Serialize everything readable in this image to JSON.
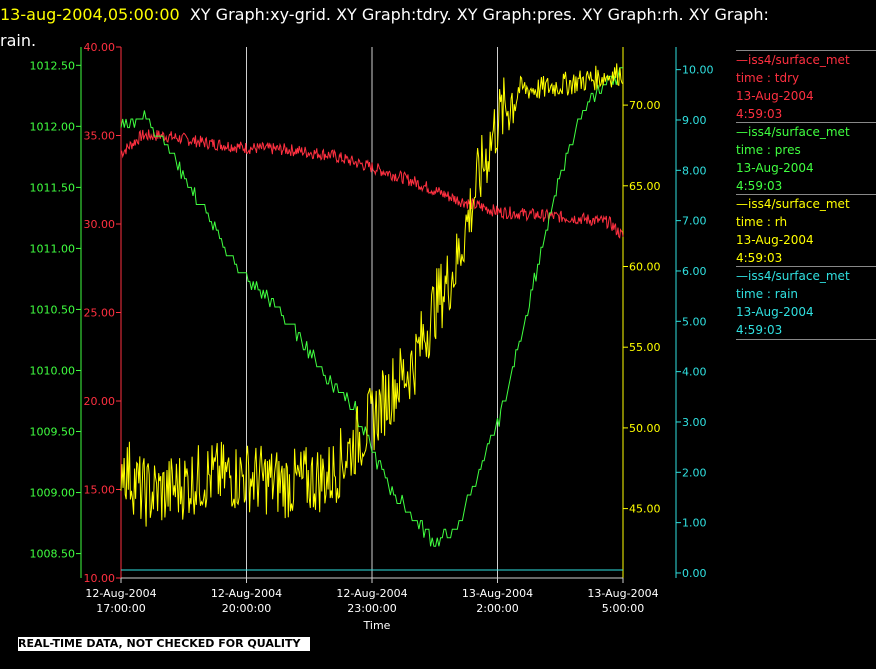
{
  "title": {
    "timestamp": "13-aug-2004,05:00:00",
    "rest_line1": "XY Graph:xy-grid.  XY Graph:tdry.  XY Graph:pres.  XY Graph:rh.  XY Graph:",
    "rest_line2": "rain."
  },
  "footer": "REAL-TIME DATA, NOT CHECKED FOR QUALITY",
  "legend": [
    {
      "name": "iss4/surface_met",
      "label": "time : tdry",
      "date": "13-Aug-2004",
      "time": "4:59:03",
      "color": "#ff3040"
    },
    {
      "name": "iss4/surface_met",
      "label": "time : pres",
      "date": "13-Aug-2004",
      "time": "4:59:03",
      "color": "#40ff40"
    },
    {
      "name": "iss4/surface_met",
      "label": "time : rh",
      "date": "13-Aug-2004",
      "time": "4:59:03",
      "color": "#ffff00"
    },
    {
      "name": "iss4/surface_met",
      "label": "time : rain",
      "date": "13-Aug-2004",
      "time": "4:59:03",
      "color": "#30e0e0"
    }
  ],
  "chart_data": {
    "type": "line",
    "xlabel": "Time",
    "xlim": [
      "2004-08-12 17:00",
      "2004-08-13 05:00"
    ],
    "x_ticks": [
      {
        "line1": "12-Aug-2004",
        "line2": "17:00:00",
        "t": 0
      },
      {
        "line1": "12-Aug-2004",
        "line2": "20:00:00",
        "t": 3
      },
      {
        "line1": "12-Aug-2004",
        "line2": "23:00:00",
        "t": 6
      },
      {
        "line1": "13-Aug-2004",
        "line2": "2:00:00",
        "t": 9
      },
      {
        "line1": "13-Aug-2004",
        "line2": "5:00:00",
        "t": 12
      }
    ],
    "grid": "vertical",
    "axes": [
      {
        "id": "pres",
        "color": "#40ff40",
        "ylim": [
          1008.3,
          1012.65
        ],
        "ticks": [
          "1008.50",
          "1009.00",
          "1009.50",
          "1010.00",
          "1010.50",
          "1011.00",
          "1011.50",
          "1012.00",
          "1012.50"
        ]
      },
      {
        "id": "tdry",
        "color": "#ff3040",
        "ylim": [
          10,
          40
        ],
        "ticks": [
          "10.00",
          "15.00",
          "20.00",
          "25.00",
          "30.00",
          "35.00",
          "40.00"
        ]
      },
      {
        "id": "rh",
        "color": "#ffff00",
        "ylim": [
          40.7,
          73.6
        ],
        "ticks": [
          "45.00",
          "50.00",
          "55.00",
          "60.00",
          "65.00",
          "70.00"
        ]
      },
      {
        "id": "rain",
        "color": "#30e0e0",
        "ylim": [
          -0.1,
          10.45
        ],
        "ticks": [
          "0.00",
          "1.00",
          "2.00",
          "3.00",
          "4.00",
          "5.00",
          "6.00",
          "7.00",
          "8.00",
          "9.00",
          "10.00"
        ]
      }
    ],
    "series": [
      {
        "axis": "tdry",
        "color": "#ff3040",
        "x": [
          "17:00",
          "17:30",
          "18:00",
          "19:00",
          "20:00",
          "21:00",
          "22:00",
          "23:00",
          "00:00",
          "01:00",
          "02:00",
          "03:00",
          "04:00",
          "04:40",
          "05:00"
        ],
        "y": [
          34.0,
          35.0,
          35.0,
          34.6,
          34.3,
          34.2,
          33.9,
          33.2,
          32.4,
          31.4,
          30.7,
          30.5,
          30.3,
          30.1,
          29.3
        ]
      },
      {
        "axis": "pres",
        "color": "#40ff40",
        "x": [
          "17:00",
          "17:30",
          "18:00",
          "18:30",
          "19:00",
          "19:30",
          "20:00",
          "20:30",
          "21:00",
          "21:30",
          "22:00",
          "22:30",
          "23:00",
          "23:30",
          "00:00",
          "00:30",
          "01:00",
          "01:30",
          "02:00",
          "02:30",
          "03:00",
          "03:30",
          "04:00",
          "04:30",
          "05:00"
        ],
        "y": [
          1012.0,
          1012.1,
          1011.9,
          1011.6,
          1011.3,
          1011.0,
          1010.75,
          1010.6,
          1010.4,
          1010.15,
          1009.9,
          1009.75,
          1009.35,
          1009.0,
          1008.8,
          1008.6,
          1008.7,
          1009.1,
          1009.55,
          1010.2,
          1010.9,
          1011.6,
          1012.1,
          1012.35,
          1012.45
        ]
      },
      {
        "axis": "rh",
        "color": "#ffff00",
        "x": [
          "17:00",
          "17:30",
          "18:00",
          "19:00",
          "20:00",
          "21:00",
          "22:00",
          "23:00",
          "23:30",
          "00:00",
          "00:30",
          "01:00",
          "01:30",
          "02:00",
          "02:30",
          "03:00",
          "04:00",
          "05:00"
        ],
        "y": [
          48.0,
          46.0,
          46.0,
          47.0,
          47.0,
          46.5,
          47.0,
          50.5,
          52.5,
          54.0,
          57.5,
          60.0,
          65.0,
          69.0,
          71.0,
          71.0,
          71.5,
          72.0
        ]
      },
      {
        "axis": "rain",
        "color": "#30e0e0",
        "x": [
          "17:00",
          "05:00"
        ],
        "y": [
          0,
          0
        ]
      }
    ]
  }
}
